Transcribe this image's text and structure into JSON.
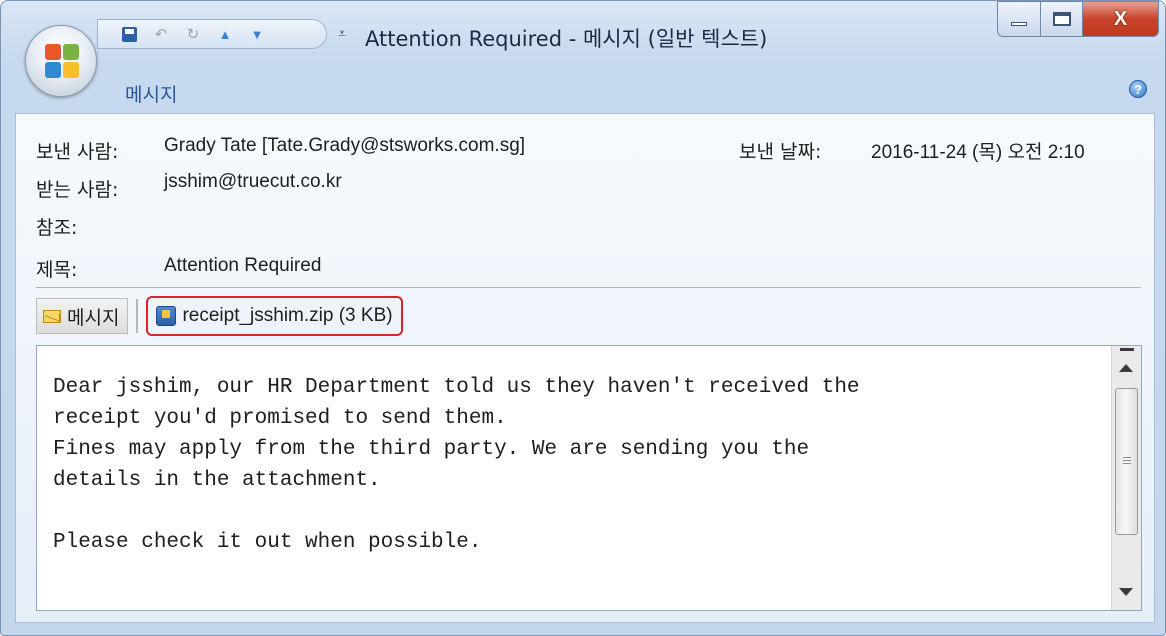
{
  "window": {
    "title": "Attention Required - 메시지 (일반 텍스트)"
  },
  "qat": {
    "icons": [
      "save-icon",
      "undo-icon",
      "redo-icon",
      "previous-item-icon",
      "next-item-icon",
      "customize-qat-icon"
    ]
  },
  "ribbon": {
    "tab_message": "메시지",
    "help_icon": "?"
  },
  "header": {
    "from_label": "보낸 사람:",
    "from_value": "Grady Tate [Tate.Grady@stsworks.com.sg]",
    "sent_label": "보낸 날짜:",
    "sent_value": "2016-11-24 (목) 오전 2:10",
    "to_label": "받는 사람:",
    "to_value": "jsshim@truecut.co.kr",
    "cc_label": "참조:",
    "cc_value": "",
    "subject_label": "제목:",
    "subject_value": "Attention Required"
  },
  "attachments": {
    "message_label": "메시지",
    "file_label": "receipt_jsshim.zip (3 KB)"
  },
  "body": {
    "text": "Dear jsshim, our HR Department told us they haven't received the\nreceipt you'd promised to send them.\nFines may apply from the third party. We are sending you the\ndetails in the attachment.\n\nPlease check it out when possible."
  },
  "colors": {
    "attachment_highlight": "#d8232a",
    "tab_text": "#2b5597",
    "close_button": "#c7432a"
  }
}
